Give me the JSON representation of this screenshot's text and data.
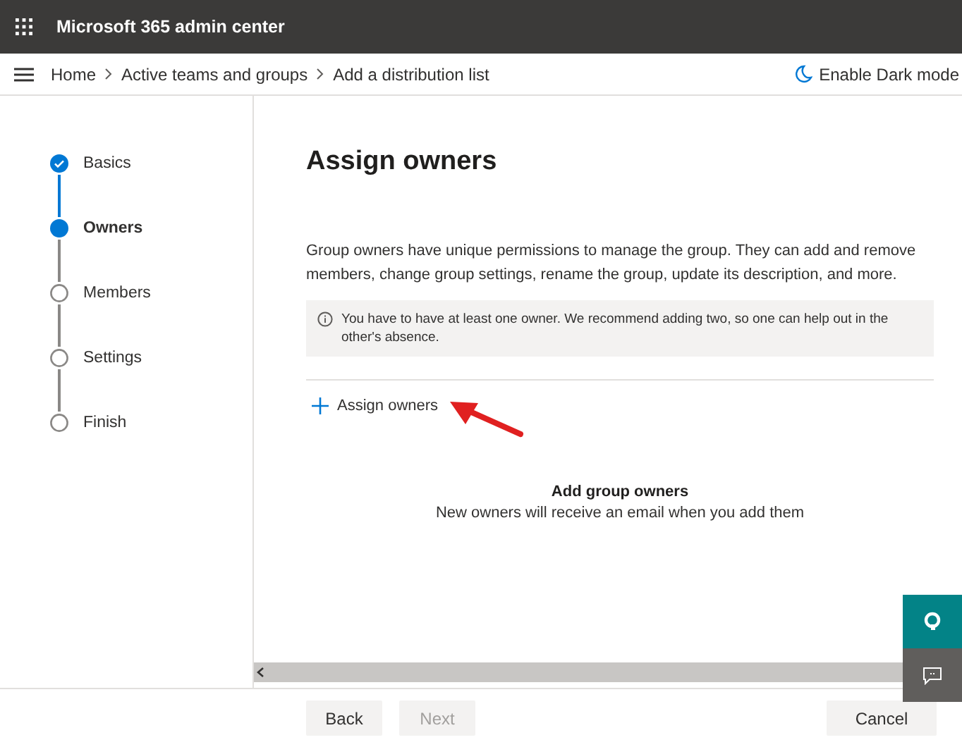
{
  "header": {
    "title": "Microsoft 365 admin center"
  },
  "breadcrumb": {
    "items": [
      "Home",
      "Active teams and groups",
      "Add a distribution list"
    ],
    "dark_mode": "Enable Dark mode"
  },
  "steps": [
    {
      "label": "Basics",
      "completed": true,
      "selected": false
    },
    {
      "label": "Owners",
      "completed": false,
      "selected": true
    },
    {
      "label": "Members",
      "completed": false,
      "selected": false
    },
    {
      "label": "Settings",
      "completed": false,
      "selected": false
    },
    {
      "label": "Finish",
      "completed": false,
      "selected": false
    }
  ],
  "main": {
    "heading": "Assign owners",
    "description": "Group owners have unique permissions to manage the group. They can add and remove members, change group settings, rename the group, update its description, and more.",
    "notice": "You have to have at least one owner. We recommend adding two, so one can help out in the other's absence.",
    "assign_button": "Assign owners",
    "empty_title": "Add group owners",
    "empty_text": "New owners will receive an email when you add them"
  },
  "footer": {
    "buttons": [
      {
        "label": "Back",
        "disabled": false
      },
      {
        "label": "Next",
        "disabled": true
      }
    ],
    "cancel": "Cancel"
  }
}
